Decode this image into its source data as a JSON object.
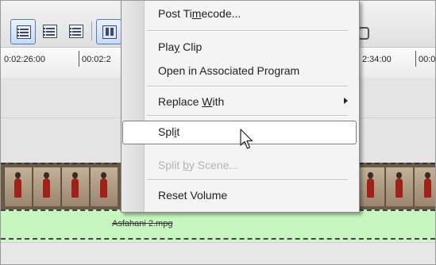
{
  "toolbar": {
    "buttons": [
      {
        "icon": "list-view-icon",
        "selected": true
      },
      {
        "icon": "list-view-icon",
        "selected": false
      },
      {
        "icon": "list-view-icon",
        "selected": false
      },
      {
        "icon": "storyboard-view-icon",
        "selected": true
      }
    ]
  },
  "ruler": {
    "labels": [
      "0:02:26:00",
      "00:02:2",
      "2:34:00",
      "00:0"
    ]
  },
  "audio_track": {
    "clip_name": "Asfahani 2.mpg"
  },
  "context_menu": {
    "items": [
      {
        "label_pre": "Post Ti",
        "label_acc": "m",
        "label_post": "ecode...",
        "enabled": true
      },
      {
        "label_pre": "Pla",
        "label_acc": "y",
        "label_post": " Clip",
        "enabled": true
      },
      {
        "label_pre": "Open in Associated Pro",
        "label_acc": "g",
        "label_post": "ram",
        "enabled": true
      },
      {
        "label_pre": "Replace ",
        "label_acc": "W",
        "label_post": "ith",
        "enabled": true,
        "submenu": true
      },
      {
        "label_pre": "Spl",
        "label_acc": "i",
        "label_post": "t",
        "enabled": true,
        "highlighted": true
      },
      {
        "label_pre": "Split ",
        "label_acc": "b",
        "label_post": "y Scene...",
        "enabled": false
      },
      {
        "label_pre": "Reset Volume",
        "label_acc": "",
        "label_post": "",
        "enabled": true
      }
    ]
  },
  "colors": {
    "audio_track": "#c8f6c0",
    "video_track": "#6b5a48",
    "selected_button": "#4f7ec0"
  }
}
